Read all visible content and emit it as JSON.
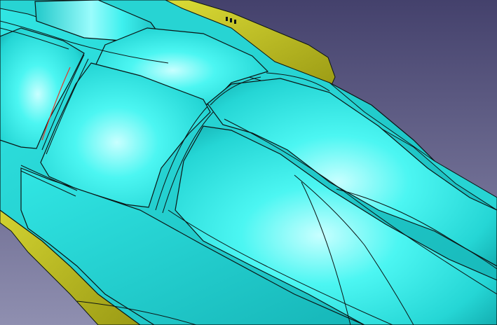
{
  "viewport": {
    "kind": "cad-3d-viewport",
    "background_top": "#44416c",
    "background_bottom": "#8f8fb0"
  },
  "model": {
    "description_colors": {
      "surface_highlight": "#c8ffff",
      "surface_main": "#2ee8e6",
      "surface_shadow": "#12a8aa",
      "flange": "#c6c61e",
      "flange_shadow": "#7f7f10",
      "edge_lines": "#0b1414",
      "highlighted_edge": "#e03a2a"
    }
  }
}
